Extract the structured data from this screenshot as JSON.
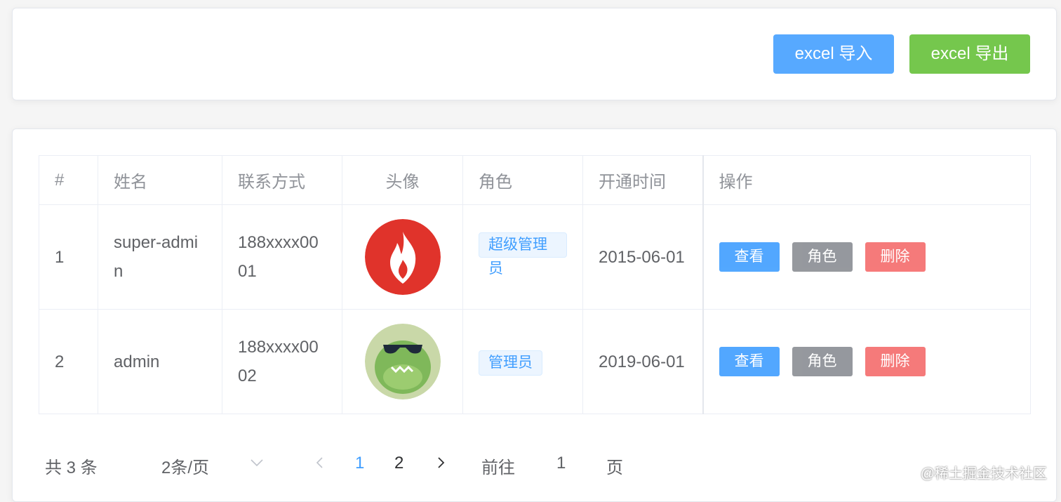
{
  "toolbar": {
    "import_label": "excel 导入",
    "export_label": "excel 导出"
  },
  "table": {
    "headers": [
      "#",
      "姓名",
      "联系方式",
      "头像",
      "角色",
      "开通时间",
      "操作"
    ],
    "rows": [
      {
        "index": "1",
        "name": "super-admin",
        "phone": "188xxxx0001",
        "avatar": "flame-avatar",
        "role": "超级管理员",
        "open_time": "2015-06-01"
      },
      {
        "index": "2",
        "name": "admin",
        "phone": "188xxxx0002",
        "avatar": "crocodile-avatar",
        "role": "管理员",
        "open_time": "2019-06-01"
      }
    ],
    "actions": {
      "view": "查看",
      "role": "角色",
      "delete": "删除"
    }
  },
  "pagination": {
    "total_text": "共 3 条",
    "page_size": "2条/页",
    "pages": [
      "1",
      "2"
    ],
    "current_page": "1",
    "goto_prefix": "前往",
    "goto_value": "1",
    "goto_suffix": "页"
  },
  "watermark": "@稀土掘金技术社区",
  "colors": {
    "primary": "#409eff",
    "success": "#67c23a",
    "info": "#909399",
    "danger": "#f56c6c"
  }
}
